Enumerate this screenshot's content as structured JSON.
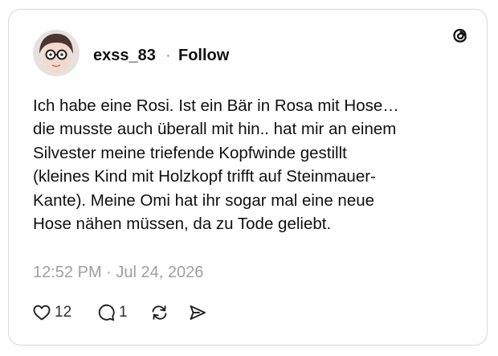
{
  "post": {
    "username": "exss_83",
    "separator": "·",
    "follow_label": "Follow",
    "text": "Ich habe eine Rosi. Ist ein Bär in Rosa mit Hose…\ndie musste auch überall mit hin.. hat mir an einem\nSilvester meine triefende Kopfwinde gestillt\n(kleines Kind mit Holzkopf trifft auf Steinmauer-\nKante). Meine Omi hat ihr sogar mal eine neue\nHose nähen müssen, da zu Tode geliebt.",
    "timestamp": "12:52 PM · Jul 24, 2026"
  },
  "actions": {
    "like_icon": "heart-icon",
    "like_count": "12",
    "reply_icon": "comment-icon",
    "reply_count": "1",
    "repost_icon": "repost-icon",
    "share_icon": "send-icon"
  },
  "branding": {
    "logo_icon": "threads-logo-icon"
  },
  "colors": {
    "text": "#101010",
    "muted": "#a0a0a0",
    "border": "#d9d9d9"
  }
}
